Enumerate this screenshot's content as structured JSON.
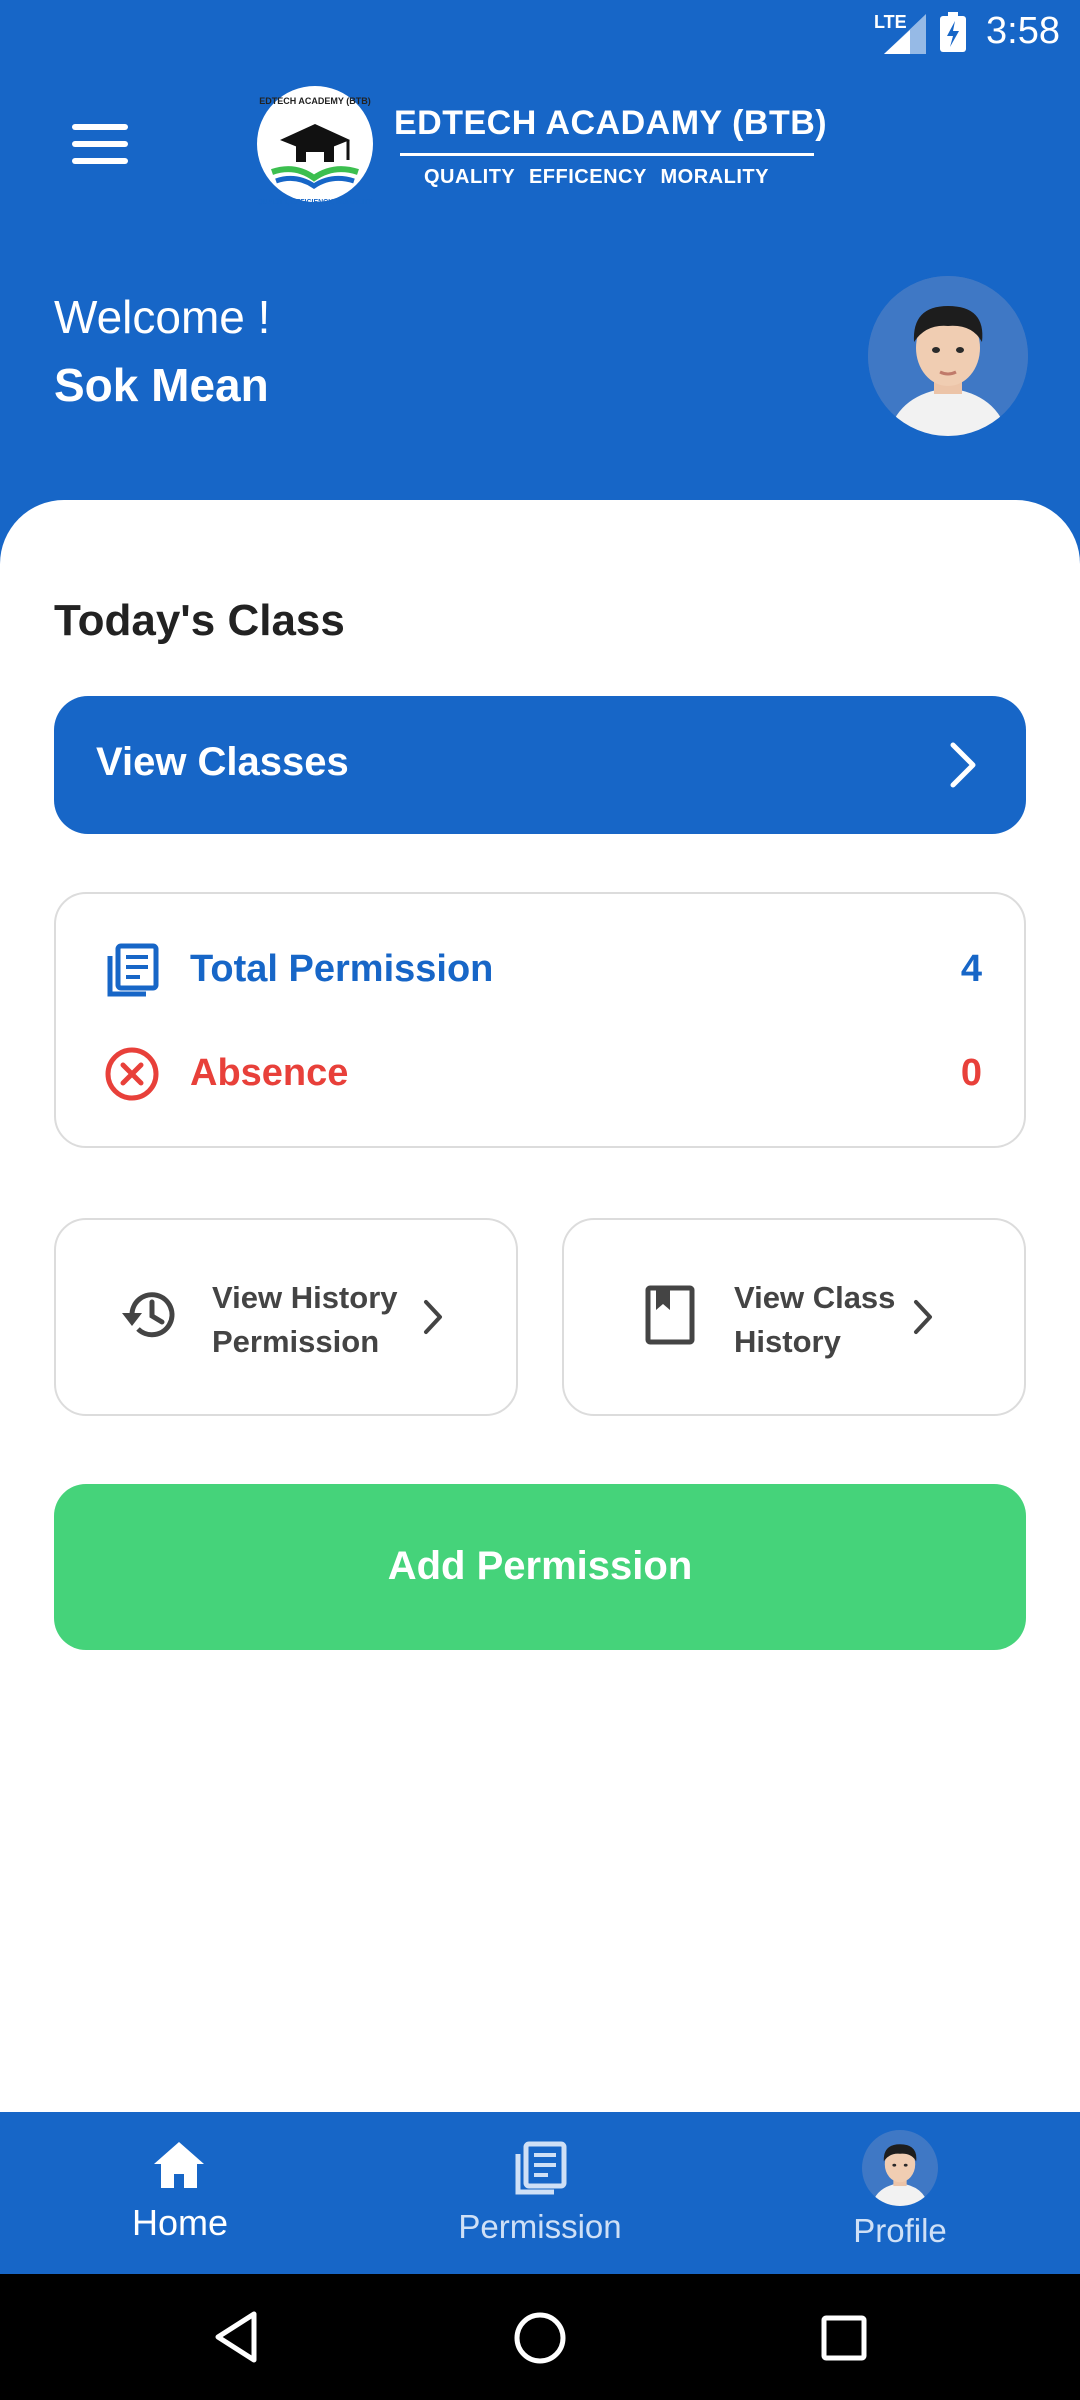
{
  "status_bar": {
    "network": "LTE",
    "time": "3:58"
  },
  "header": {
    "brand_title": "EDTECH ACADAMY (BTB)",
    "brand_tagline": "QUALITY  EFFICENCY   MORALITY",
    "logo_ring_text": "EDTECH ACADEMY (BTB)",
    "logo_sub_text": "QUALITY, EFFICIENCY, MORALITY",
    "welcome": "Welcome !",
    "user_name": "Sok Mean"
  },
  "main": {
    "section_title": "Today's Class",
    "view_classes_label": "View Classes",
    "stats": {
      "total_permission_label": "Total Permission",
      "total_permission_value": "4",
      "absence_label": "Absence",
      "absence_value": "0"
    },
    "cards": {
      "history_permission_line1": "View History",
      "history_permission_line2": "Permission",
      "class_history_line1": "View Class",
      "class_history_line2": "History"
    },
    "add_permission_label": "Add Permission"
  },
  "bottom_nav": {
    "items": [
      {
        "label": "Home",
        "icon": "home-icon",
        "active": true
      },
      {
        "label": "Permission",
        "icon": "document-list-icon",
        "active": false
      },
      {
        "label": "Profile",
        "icon": "avatar",
        "active": false
      }
    ]
  },
  "colors": {
    "primary": "#1766c7",
    "success": "#45d37a",
    "danger": "#e8403a",
    "text": "#222222"
  }
}
